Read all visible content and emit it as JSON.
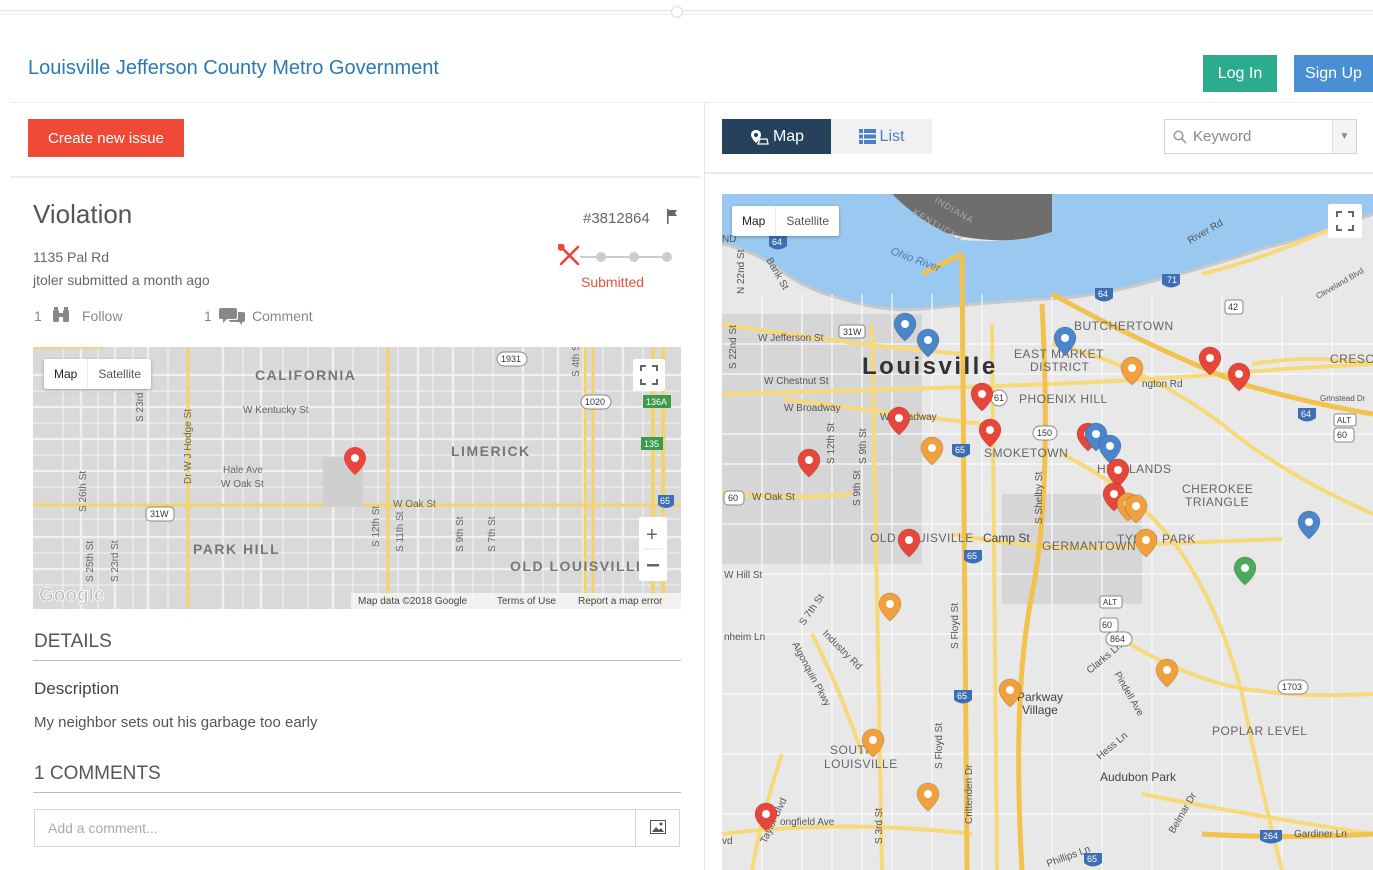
{
  "header": {
    "org_title": "Louisville Jefferson County Metro Government",
    "login_label": "Log In",
    "signup_label": "Sign Up"
  },
  "left": {
    "create_label": "Create new issue",
    "issue": {
      "title": "Violation",
      "id": "#3812864",
      "address": "1135 Pal Rd",
      "submitter": "jtoler submitted a month ago",
      "status": "Submitted",
      "follow_count": "1",
      "follow_label": "Follow",
      "comment_count": "1",
      "comment_label": "Comment"
    },
    "mini_map": {
      "map_label": "Map",
      "satellite_label": "Satellite",
      "labels": {
        "california": "CALIFORNIA",
        "limerick": "LIMERICK",
        "park_hill": "PARK HILL",
        "old_louisville": "OLD LOUISVILLE",
        "w_kentucky": "W Kentucky St",
        "hale": "Hale Ave",
        "w_oak": "W Oak St",
        "w_oak2": "W Oak St",
        "hodge": "Dr W J Hodge St",
        "s26": "S 26th St",
        "s25": "S 25th St",
        "s23": "S 23rd St",
        "s23b": "S 23rd",
        "s12": "S 12th St",
        "s11": "S 11th St",
        "s9": "S 9th St",
        "s7": "S 7th St",
        "s4": "S 4th St",
        "rt1931": "1931",
        "rt1020": "1020",
        "rt136a": "136A",
        "rt135": "135",
        "rt31w": "31W",
        "rt65": "65",
        "google": "Google",
        "map_data": "Map data ©2018 Google",
        "terms": "Terms of Use",
        "report": "Report a map error"
      }
    },
    "details_heading": "DETAILS",
    "description_heading": "Description",
    "description_text": "My neighbor sets out his garbage too early",
    "comments_heading": "1 COMMENTS",
    "comment_placeholder": "Add a comment..."
  },
  "right": {
    "tab_map": "Map",
    "tab_list": "List",
    "keyword_placeholder": "Keyword",
    "main_map": {
      "map_label": "Map",
      "satellite_label": "Satellite",
      "labels": {
        "louisville": "Louisville",
        "ohio_river": "Ohio River",
        "indiana": "INDIANA",
        "kentucky": "KENTUCKY",
        "butchertown": "BUTCHERTOWN",
        "east_market": "EAST MARKET",
        "district": "DISTRICT",
        "phoenix_hill": "PHOENIX HILL",
        "smoketown": "SMOKETOWN",
        "highlands": "HIGHLANDS",
        "cherokee": "CHEROKEE",
        "triangle": "TRIANGLE",
        "tyler_park": "TYLER PARK",
        "germantown": "GERMANTOWN",
        "old_louisville": "OLD LOUISVILLE",
        "camp_st": "Camp St",
        "parkway": "Parkway",
        "village": "Village",
        "south": "SOUTH",
        "louisville2": "LOUISVILLE",
        "poplar": "POPLAR LEVEL",
        "audubon": "Audubon Park",
        "cresc": "CRESC",
        "w_jefferson": "W Jefferson St",
        "w_chestnut": "W Chestnut St",
        "w_broadway": "W Broadway",
        "w_broadway2": "W Broadway",
        "w_oak": "W Oak St",
        "w_hill": "W Hill St",
        "river_rd": "River Rd",
        "lexington": "ngton Rd",
        "longfield": "ongfield Ave",
        "taylor": "Taylor Blvd",
        "algonquin": "Algonquin Pkwy",
        "industry": "Industry Rd",
        "s7": "S 7th St",
        "s12": "S 12th St",
        "s9": "S 9th St",
        "s3": "S 3rd St",
        "s22": "S 22nd St",
        "n22": "N 22nd St",
        "floyd": "S Floyd St",
        "floyd2": "S Floyd St",
        "shelby": "S Shelby St",
        "crittenden": "Crittenden Dr",
        "clarks": "Clarks Ln",
        "pindell": "Pindell Ave",
        "hess": "Hess Ln",
        "belmar": "Belmar Dr",
        "gardiner": "Gardiner Ln",
        "phillips": "Phillips Ln",
        "grinstead": "Grinstead Dr",
        "cleveland": "Cleveland Blvd",
        "bank": "Bank St",
        "nheim": "nheim Ln",
        "vd": "vd",
        "nd": "ND",
        "rt31w": "31W",
        "rt64": "64",
        "rt64b": "64",
        "rt71": "71",
        "rt42": "42",
        "rt61": "61",
        "rt150": "150",
        "rt65": "65",
        "rt65b": "65",
        "rt65c": "65",
        "rt65d": "65",
        "rt60": "60",
        "rt60b": "60",
        "rt60c": "60",
        "rt864": "864",
        "rt1703": "1703",
        "rt264": "264",
        "rt65e": "65",
        "rtalt": "ALT",
        "rtalt2": "ALT",
        "rt64c": "64",
        "rt64d": "64"
      }
    }
  },
  "colors": {
    "pin_red": "#e8463a",
    "pin_blue": "#4a86c9",
    "pin_orange": "#f0a03c",
    "pin_green": "#4caa5c",
    "login_green": "#2cab8f",
    "signup_blue": "#4a8fd4",
    "create_red": "#ee4a35",
    "map_tab": "#26415c"
  }
}
